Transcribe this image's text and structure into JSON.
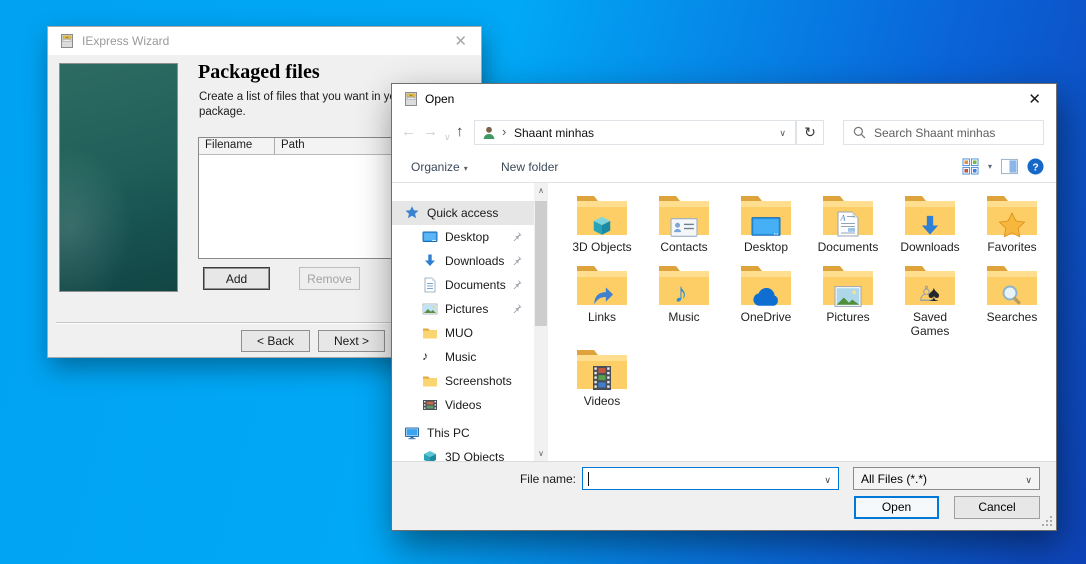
{
  "iexpress_wizard": {
    "title": "IExpress Wizard",
    "close_glyph": "✕",
    "heading": "Packaged files",
    "description_line1": "Create a list of files that you want in your",
    "description_line2": "package.",
    "list_columns": [
      "Filename",
      "Path"
    ],
    "buttons": {
      "add": "Add",
      "remove": "Remove",
      "back": "< Back",
      "next": "Next >"
    }
  },
  "open_dialog": {
    "title": "Open",
    "close_glyph": "✕",
    "nav": {
      "back_glyph": "←",
      "forward_glyph": "→",
      "drop_glyph": "∨",
      "up_glyph": "↑",
      "refresh_glyph": "↻",
      "breadcrumb_chevron": "›"
    },
    "address_location": "Shaant minhas",
    "search_placeholder": "Search Shaant minhas",
    "toolbar": {
      "organize": "Organize",
      "new_folder": "New folder",
      "dropdown_glyph": "▾"
    },
    "sidebar": {
      "items": [
        {
          "label": "Quick access",
          "icon": "quick-access-star",
          "level": 0,
          "selected": true
        },
        {
          "label": "Desktop",
          "icon": "desktop",
          "level": 1,
          "pinned": true
        },
        {
          "label": "Downloads",
          "icon": "downloads",
          "level": 1,
          "pinned": true
        },
        {
          "label": "Documents",
          "icon": "documents",
          "level": 1,
          "pinned": true
        },
        {
          "label": "Pictures",
          "icon": "pictures",
          "level": 1,
          "pinned": true
        },
        {
          "label": "MUO",
          "icon": "folder-small",
          "level": 1
        },
        {
          "label": "Music",
          "icon": "music-note-small",
          "level": 1
        },
        {
          "label": "Screenshots",
          "icon": "folder-small",
          "level": 1
        },
        {
          "label": "Videos",
          "icon": "videos-small",
          "level": 1
        },
        {
          "label": "This PC",
          "icon": "this-pc",
          "level": 0,
          "group_gap": true
        },
        {
          "label": "3D Objects",
          "icon": "cube-small",
          "level": 1,
          "partial": true
        }
      ]
    },
    "files": {
      "items": [
        {
          "label": "3D Objects",
          "overlay": "cube"
        },
        {
          "label": "Contacts",
          "overlay": "contact"
        },
        {
          "label": "Desktop",
          "overlay": "monitor"
        },
        {
          "label": "Documents",
          "overlay": "document"
        },
        {
          "label": "Downloads",
          "overlay": "down-arrow"
        },
        {
          "label": "Favorites",
          "overlay": "star"
        },
        {
          "label": "Links",
          "overlay": "link-arrow"
        },
        {
          "label": "Music",
          "overlay": "music-note"
        },
        {
          "label": "OneDrive",
          "overlay": "cloud"
        },
        {
          "label": "Pictures",
          "overlay": "picture"
        },
        {
          "label": "Saved Games",
          "overlay": "chess"
        },
        {
          "label": "Searches",
          "overlay": "magnifier"
        },
        {
          "label": "Videos",
          "overlay": "filmstrip"
        }
      ]
    },
    "scrollbar": {
      "up_glyph": "∧",
      "down_glyph": "∨"
    },
    "footer": {
      "file_name_label": "File name:",
      "file_name_value": "",
      "file_type_value": "All Files (*.*)",
      "open": "Open",
      "cancel": "Cancel"
    }
  },
  "colors": {
    "accent_blue": "#0078d7",
    "desktop_from": "#00a2f1",
    "desktop_to": "#0e43b8",
    "folder_yellow": "#fed06a"
  }
}
